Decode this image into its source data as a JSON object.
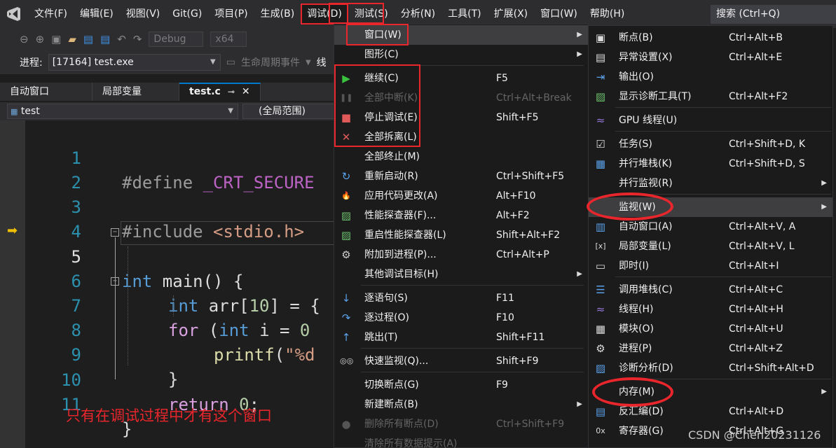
{
  "menubar": {
    "items": [
      "文件(F)",
      "编辑(E)",
      "视图(V)",
      "Git(G)",
      "项目(P)",
      "生成(B)",
      "调试(D)",
      "测试(S)",
      "分析(N)",
      "工具(T)",
      "扩展(X)",
      "窗口(W)",
      "帮助(H)"
    ],
    "search": "搜索 (Ctrl+Q)"
  },
  "toolbar": {
    "config": "Debug",
    "platform": "x64"
  },
  "process": {
    "label": "进程:",
    "value": "[17164] test.exe",
    "lifecycle": "生命周期事件",
    "extra": "线"
  },
  "tabs": [
    {
      "label": "自动窗口"
    },
    {
      "label": "局部变量"
    },
    {
      "label": "test.c",
      "pin": "⊸",
      "close": "✕"
    }
  ],
  "nav": {
    "file": "test",
    "scope": "(全局范围)"
  },
  "editor": {
    "line_numbers": [
      "1",
      "2",
      "3",
      "4",
      "5",
      "6",
      "7",
      "8",
      "9",
      "10",
      "11"
    ],
    "l1_pp": "#define ",
    "l1_mac": "_CRT_SECURE",
    "l3_pp": "#include ",
    "l3_str": "<stdio.h>",
    "l5_kw": "int",
    "l5_rest": " main() {",
    "l6_kw": "int",
    "l6_rest": " arr[",
    "l6_num": "10",
    "l6_rest2": "] = {",
    "l7_ctl": "for",
    "l7_rest": " (",
    "l7_kw": "int",
    "l7_rest2": " i = ",
    "l7_num": "0",
    "l8_fn": "printf",
    "l8_rest": "(",
    "l8_str": "\"%d",
    "l9": "}",
    "l10_ctl": "return",
    "l10_rest": " ",
    "l10_num": "0",
    "l10_rest2": ";",
    "l11": "}"
  },
  "note": "只有在调试过程中才有这个窗口",
  "debug_menu": [
    {
      "label": "窗口(W)",
      "shortcut": "",
      "icon": "",
      "sub": true
    },
    {
      "label": "图形(C)",
      "shortcut": "",
      "icon": "",
      "sub": true
    },
    {
      "label": "继续(C)",
      "shortcut": "F5",
      "icon": "play-icon"
    },
    {
      "label": "全部中断(K)",
      "shortcut": "Ctrl+Alt+Break",
      "icon": "pause-icon",
      "disabled": true
    },
    {
      "label": "停止调试(E)",
      "shortcut": "Shift+F5",
      "icon": "stop-icon"
    },
    {
      "label": "全部拆离(L)",
      "shortcut": "",
      "icon": "detach-icon"
    },
    {
      "label": "全部终止(M)",
      "shortcut": "",
      "icon": ""
    },
    {
      "label": "重新启动(R)",
      "shortcut": "Ctrl+Shift+F5",
      "icon": "restart-icon"
    },
    {
      "label": "应用代码更改(A)",
      "shortcut": "Alt+F10",
      "icon": "hot-reload-icon"
    },
    {
      "label": "性能探查器(F)...",
      "shortcut": "Alt+F2",
      "icon": "profiler-icon"
    },
    {
      "label": "重启性能探查器(L)",
      "shortcut": "Shift+Alt+F2",
      "icon": "profiler-restart-icon"
    },
    {
      "label": "附加到进程(P)...",
      "shortcut": "Ctrl+Alt+P",
      "icon": "attach-icon"
    },
    {
      "label": "其他调试目标(H)",
      "shortcut": "",
      "icon": "",
      "sub": true
    },
    {
      "label": "逐语句(S)",
      "shortcut": "F11",
      "icon": "step-into-icon"
    },
    {
      "label": "逐过程(O)",
      "shortcut": "F10",
      "icon": "step-over-icon"
    },
    {
      "label": "跳出(T)",
      "shortcut": "Shift+F11",
      "icon": "step-out-icon"
    },
    {
      "label": "快速监视(Q)...",
      "shortcut": "Shift+F9",
      "icon": "quickwatch-icon"
    },
    {
      "label": "切换断点(G)",
      "shortcut": "F9",
      "icon": ""
    },
    {
      "label": "新建断点(B)",
      "shortcut": "",
      "icon": "",
      "sub": true
    },
    {
      "label": "删除所有断点(D)",
      "shortcut": "Ctrl+Shift+F9",
      "icon": "delete-breakpoints-icon",
      "disabled": true
    },
    {
      "label": "清除所有数据提示(A)",
      "shortcut": "",
      "icon": "",
      "disabled": true
    }
  ],
  "window_menu": [
    {
      "label": "断点(B)",
      "shortcut": "Ctrl+Alt+B",
      "icon": "breakpoints-window-icon"
    },
    {
      "label": "异常设置(X)",
      "shortcut": "Ctrl+Alt+E",
      "icon": "exception-settings-icon"
    },
    {
      "label": "输出(O)",
      "shortcut": "",
      "icon": "output-icon"
    },
    {
      "label": "显示诊断工具(T)",
      "shortcut": "Ctrl+Alt+F2",
      "icon": "diagnostics-icon"
    },
    {
      "label": "GPU 线程(U)",
      "shortcut": "",
      "icon": "gpu-threads-icon"
    },
    {
      "label": "任务(S)",
      "shortcut": "Ctrl+Shift+D, K",
      "icon": "tasks-icon"
    },
    {
      "label": "并行堆栈(K)",
      "shortcut": "Ctrl+Shift+D, S",
      "icon": "parallel-stacks-icon"
    },
    {
      "label": "并行监视(R)",
      "shortcut": "",
      "icon": "",
      "sub": true
    },
    {
      "label": "监视(W)",
      "shortcut": "",
      "icon": "",
      "sub": true
    },
    {
      "label": "自动窗口(A)",
      "shortcut": "Ctrl+Alt+V, A",
      "icon": "autos-icon"
    },
    {
      "label": "局部变量(L)",
      "shortcut": "Ctrl+Alt+V, L",
      "icon": "locals-icon"
    },
    {
      "label": "即时(I)",
      "shortcut": "Ctrl+Alt+I",
      "icon": "immediate-icon"
    },
    {
      "label": "调用堆栈(C)",
      "shortcut": "Ctrl+Alt+C",
      "icon": "call-stack-icon"
    },
    {
      "label": "线程(H)",
      "shortcut": "Ctrl+Alt+H",
      "icon": "threads-icon"
    },
    {
      "label": "模块(O)",
      "shortcut": "Ctrl+Alt+U",
      "icon": "modules-icon"
    },
    {
      "label": "进程(P)",
      "shortcut": "Ctrl+Alt+Z",
      "icon": "processes-icon"
    },
    {
      "label": "诊断分析(D)",
      "shortcut": "Ctrl+Shift+Alt+D",
      "icon": "diagnostic-analysis-icon"
    },
    {
      "label": "内存(M)",
      "shortcut": "",
      "icon": "",
      "sub": true
    },
    {
      "label": "反汇编(D)",
      "shortcut": "Ctrl+Alt+D",
      "icon": "disassembly-icon"
    },
    {
      "label": "寄存器(G)",
      "shortcut": "Ctrl+Alt+G",
      "icon": "registers-icon"
    }
  ],
  "watermark": "CSDN @Chen20231126",
  "colors": {
    "accent": "#007acc",
    "annotation": "#e8262b",
    "menu_bg": "#1b1b1c"
  }
}
